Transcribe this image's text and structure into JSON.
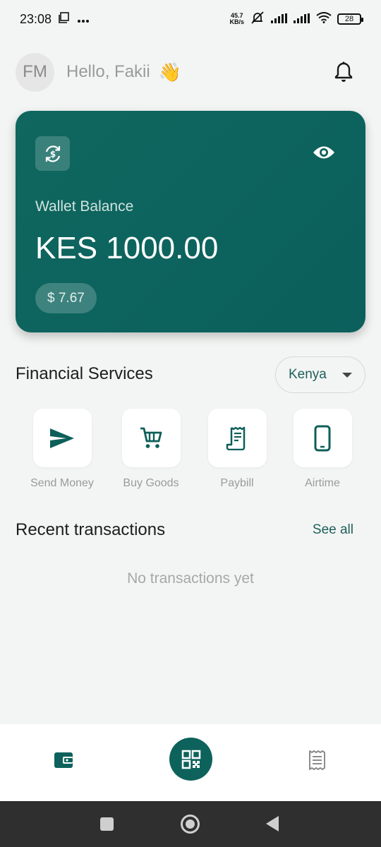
{
  "status_bar": {
    "time": "23:08",
    "net_speed_value": "45.7",
    "net_speed_unit": "KB/s",
    "battery": "28",
    "icons": [
      "screenshot-icon",
      "more-dots-icon",
      "mute-icon",
      "signal-icon",
      "wifi-icon",
      "battery-icon"
    ]
  },
  "header": {
    "avatar_initials": "FM",
    "greeting": "Hello, Fakii",
    "wave_emoji": "👋",
    "icons": [
      "bell-icon"
    ]
  },
  "wallet": {
    "label": "Wallet Balance",
    "amount": "KES 1000.00",
    "usd_amount": "$ 7.67",
    "card_color": "#0b605c",
    "icons": [
      "currency-exchange-icon",
      "eye-icon"
    ]
  },
  "financial_services": {
    "title": "Financial Services",
    "country": "Kenya",
    "items": [
      {
        "label": "Send Money",
        "icon": "send-icon"
      },
      {
        "label": "Buy Goods",
        "icon": "cart-icon"
      },
      {
        "label": "Paybill",
        "icon": "receipt-icon"
      },
      {
        "label": "Airtime",
        "icon": "phone-icon"
      }
    ]
  },
  "recent_transactions": {
    "title": "Recent transactions",
    "see_all": "See all",
    "empty_message": "No transactions yet"
  },
  "bottom_nav": {
    "icons": [
      "wallet-icon",
      "qr-code-icon",
      "receipts-icon"
    ],
    "accent": "#0e625c"
  },
  "system_nav": {
    "icons": [
      "recents-icon",
      "home-icon",
      "back-icon"
    ]
  }
}
